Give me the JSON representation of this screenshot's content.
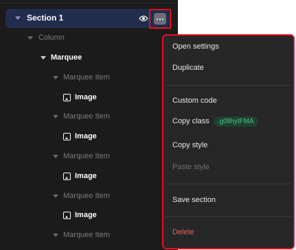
{
  "tree": {
    "section": {
      "label": "Section 1"
    },
    "column": {
      "label": "Column"
    },
    "marquee": {
      "label": "Marquee"
    },
    "marquee_item_label": "Marquee Item",
    "image_label": "Image"
  },
  "menu": {
    "open_settings": "Open settings",
    "duplicate": "Duplicate",
    "custom_code": "Custom code",
    "copy_class": "Copy class",
    "class_name": ".g0llhytFMA",
    "copy_style": "Copy style",
    "paste_style": "Paste style",
    "save_section": "Save section",
    "delete": "Delete"
  },
  "colors": {
    "highlight_outline": "#e8101c",
    "selected_row": "#222c4d",
    "class_chip_text": "#4bc48a",
    "delete_text": "#e06060"
  }
}
